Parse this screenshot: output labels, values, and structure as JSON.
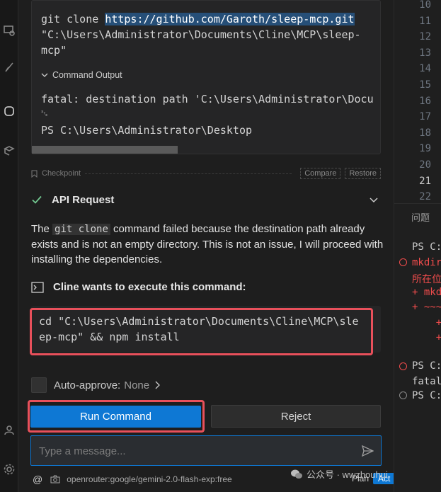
{
  "command_block": {
    "line1_prefix": "git clone ",
    "line1_url": "https://github.com/Garoth/sleep-mcp.git",
    "line2": "\"C:\\Users\\Administrator\\Documents\\Cline\\MCP\\sleep-",
    "line3": "mcp\"",
    "output_toggle": "Command Output",
    "output_line1": "fatal: destination path 'C:\\Users\\Administrator\\Docu",
    "output_line2": "␂",
    "output_line3": "PS C:\\Users\\Administrator\\Desktop"
  },
  "checkpoint": {
    "label": "Checkpoint",
    "compare": "Compare",
    "restore": "Restore"
  },
  "api_request": {
    "label": "API Request"
  },
  "message": {
    "before": "The ",
    "code": "git clone",
    "after": " command failed because the destination path already exists and is not an empty directory. This is not an issue, I will proceed with installing the dependencies."
  },
  "execute": {
    "label": "Cline wants to execute this command:",
    "line1": "cd \"C:\\Users\\Administrator\\Documents\\Cline\\MCP\\sle",
    "line2": "ep-mcp\" && npm install"
  },
  "auto_approve": {
    "label": "Auto-approve:",
    "value": "None"
  },
  "buttons": {
    "run": "Run Command",
    "reject": "Reject"
  },
  "input": {
    "placeholder": "Type a message..."
  },
  "footer": {
    "at": "@",
    "model": "openrouter:google/gemini-2.0-flash-exp:free",
    "plan": "Plan",
    "act": "Act"
  },
  "editor": {
    "line_numbers": [
      "10",
      "11",
      "12",
      "13",
      "14",
      "15",
      "16",
      "17",
      "18",
      "19",
      "20",
      "21",
      "22"
    ],
    "current_line": "21"
  },
  "bottom_panel": {
    "tab": "问题",
    "lines": [
      "PS C:",
      "mkdir",
      "所在位",
      "+ mkd",
      "+ ~~~",
      "    +",
      "    +",
      "",
      "PS C:",
      "fatal",
      "PS C:"
    ]
  },
  "watermark": {
    "text": "公众号 · wwzhouhui"
  },
  "colors": {
    "accent": "#0e78d4",
    "highlight_box": "#e8505b",
    "success_check": "#73c991",
    "error": "#f14c4c"
  }
}
